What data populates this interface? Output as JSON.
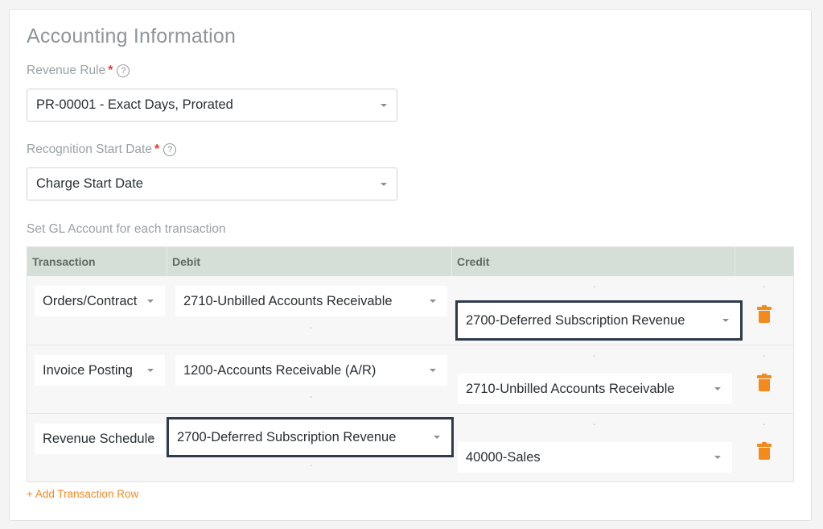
{
  "section": {
    "title": "Accounting Information"
  },
  "revenue_rule": {
    "label": "Revenue Rule",
    "required_mark": "*",
    "help_icon": "?",
    "value": "PR-00001 - Exact Days, Prorated"
  },
  "recognition_start": {
    "label": "Recognition Start Date",
    "required_mark": "*",
    "help_icon": "?",
    "value": "Charge Start Date"
  },
  "gl": {
    "label": "Set GL Account for each transaction",
    "columns": [
      "Transaction",
      "Debit",
      "Credit"
    ],
    "placeholder_dash": "-",
    "rows": [
      {
        "transaction": "Orders/Contract",
        "debit": "2710-Unbilled Accounts Receivable",
        "credit": "2700-Deferred Subscription Revenue"
      },
      {
        "transaction": "Invoice Posting",
        "debit": "1200-Accounts Receivable (A/R)",
        "credit": "2710-Unbilled Accounts Receivable"
      },
      {
        "transaction": "Revenue Schedule",
        "debit": "2700-Deferred Subscription Revenue",
        "credit": "40000-Sales"
      }
    ],
    "add_row_label": "+ Add Transaction Row"
  },
  "colors": {
    "accent": "#f08a24",
    "header_bg": "#d5dfd7",
    "highlight_border": "#2f3a4d",
    "required": "#e03b2a"
  },
  "icons": {
    "delete": "trash-icon",
    "dropdown": "caret-down-icon",
    "help": "help-circle-icon"
  }
}
